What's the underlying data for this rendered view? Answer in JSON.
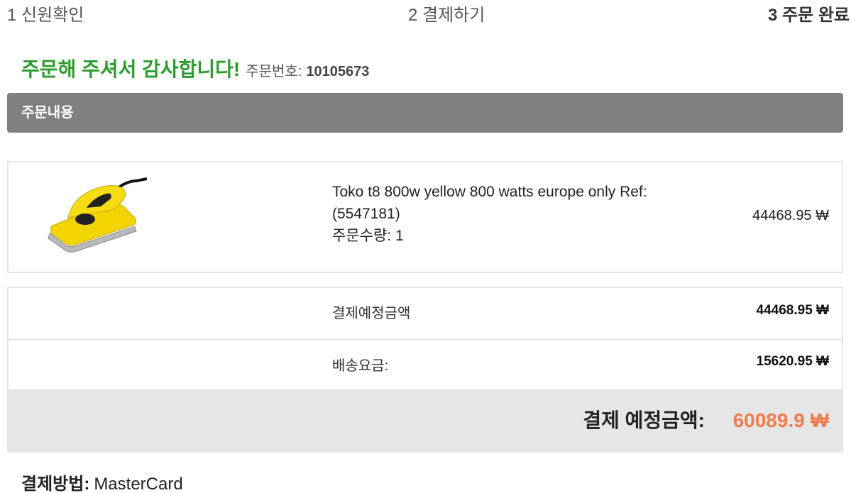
{
  "steps": [
    {
      "label": "1 신원확인"
    },
    {
      "label": "2 결제하기"
    },
    {
      "label": "3 주문 완료"
    }
  ],
  "confirmation": {
    "thanks": "주문해 주셔서 감사합니다!",
    "order_number_label": "주문번호:",
    "order_number": "10105673"
  },
  "order_section": {
    "title": "주문내용"
  },
  "items": [
    {
      "image_icon": "wax-iron-image",
      "name": "Toko t8 800w yellow 800 watts europe only Ref: (5547181)",
      "quantity_label": "주문수량:",
      "quantity": "1",
      "price": "44468.95 ₩"
    }
  ],
  "summary": {
    "subtotal_label": "결제예정금액",
    "subtotal": "44468.95 ₩",
    "shipping_label": "배송요금:",
    "shipping": "15620.95 ₩",
    "total_label": "결제 예정금액:",
    "total": "60089.9 ₩"
  },
  "payment": {
    "method_label": "결제방법:",
    "method": "MasterCard"
  },
  "colors": {
    "thanks_green": "#2e9c2e",
    "total_orange": "#ef7d4f",
    "section_bar": "#808080",
    "box_border": "#e6e6e6"
  }
}
